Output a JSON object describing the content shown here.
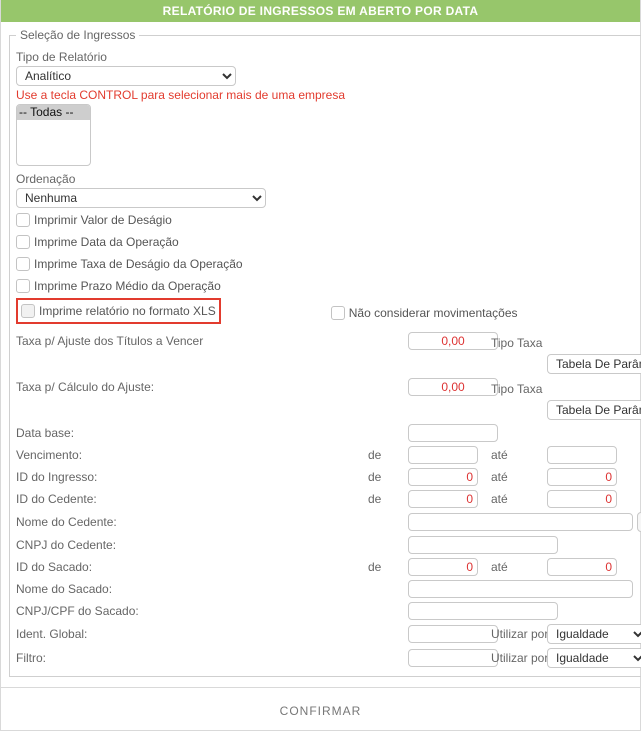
{
  "title": "RELATÓRIO DE INGRESSOS EM ABERTO POR DATA",
  "group_title": "Seleção de Ingressos",
  "tipo_relatorio": {
    "label": "Tipo de Relatório",
    "value": "Analítico"
  },
  "empresa_hint": "Use a tecla CONTROL para selecionar mais de uma empresa",
  "empresa_options": [
    "-- Todas --"
  ],
  "ordenacao": {
    "label": "Ordenação",
    "value": "Nenhuma"
  },
  "checks": {
    "valor_desagio": "Imprimir Valor de Deságio",
    "data_operacao": "Imprime Data da Operação",
    "taxa_desagio": "Imprime Taxa de Deságio da Operação",
    "prazo_medio": "Imprime Prazo Médio da Operação",
    "rel_xls": "Imprime relatório no formato XLS",
    "nao_considerar": "Não considerar movimentações"
  },
  "tipo_taxa_label": "Tipo Taxa",
  "tipo_taxa_value": "Tabela De Parâmetros",
  "fields": {
    "taxa_ajuste_titulos": {
      "label": "Taxa p/ Ajuste dos Títulos a Vencer",
      "value": "0,00"
    },
    "taxa_calculo_ajuste": {
      "label": "Taxa p/ Cálculo do Ajuste:",
      "value": "0,00"
    },
    "data_base": {
      "label": "Data base:"
    },
    "vencimento": {
      "label": "Vencimento:"
    },
    "id_ingresso": {
      "label": "ID do Ingresso:",
      "de": "0",
      "ate": "0"
    },
    "id_cedente": {
      "label": "ID do Cedente:",
      "de": "0",
      "ate": "0"
    },
    "nome_cedente": {
      "label": "Nome do Cedente:"
    },
    "cnpj_cedente": {
      "label": "CNPJ do Cedente:"
    },
    "id_sacado": {
      "label": "ID do Sacado:",
      "de": "0",
      "ate": "0"
    },
    "nome_sacado": {
      "label": "Nome do Sacado:"
    },
    "cnpj_cpf_sacado": {
      "label": "CNPJ/CPF do Sacado:"
    },
    "ident_global": {
      "label": "Ident. Global:"
    },
    "filtro": {
      "label": "Filtro:"
    }
  },
  "range_labels": {
    "de": "de",
    "ate": "até"
  },
  "utilizar_por": {
    "label": "Utilizar por:",
    "value": "Igualdade"
  },
  "lookup_btn": "...",
  "confirm": "CONFIRMAR"
}
